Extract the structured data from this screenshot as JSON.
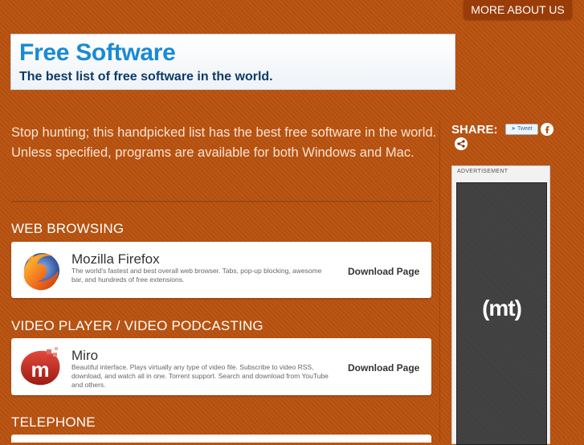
{
  "header": {
    "about_label": "MORE ABOUT US"
  },
  "banner": {
    "title": "Free Software",
    "subtitle": "The best list of free software in the world."
  },
  "intro": "Stop hunting; this handpicked list has the best free software in the world. Unless specified, programs are available for both Windows and Mac.",
  "sections": [
    {
      "heading": "WEB BROWSING",
      "item": {
        "name": "Mozilla Firefox",
        "desc": "The world's fastest and best overall web browser. Tabs, pop-up blocking, awesome bar, and hundreds of free extensions.",
        "link": "Download Page"
      }
    },
    {
      "heading": "VIDEO PLAYER / VIDEO PODCASTING",
      "item": {
        "name": "Miro",
        "desc": "Beautiful interface. Plays virtually any type of video file. Subscribe to video RSS, download, and watch all in one. Torrent support. Search and download from YouTube and others.",
        "link": "Download Page"
      }
    },
    {
      "heading": "TELEPHONE"
    }
  ],
  "share": {
    "label": "SHARE:",
    "tweet_label": "Tweet"
  },
  "ad": {
    "label": "ADVERTISEMENT",
    "logo_text": "(mt)"
  },
  "colors": {
    "background": "#b9520f",
    "accent_button": "#9a3c08",
    "banner_blue": "#1a8ad4"
  },
  "icons": [
    "firefox-icon",
    "miro-icon",
    "facebook-icon",
    "share-icon",
    "twitter-bird-icon"
  ]
}
